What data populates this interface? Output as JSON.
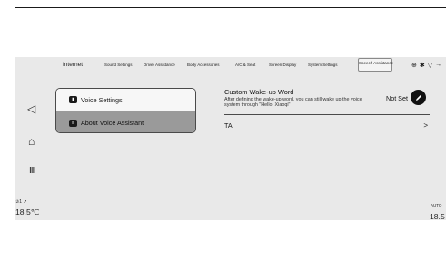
{
  "topbar": {
    "tabs": [
      {
        "label": "Internet"
      },
      {
        "label": "Sound Settings"
      },
      {
        "label": "Driver Assistance"
      },
      {
        "label": "Body Accessories"
      },
      {
        "label": "A/C & Seat"
      },
      {
        "label": "Screen Display"
      },
      {
        "label": "System Settings"
      },
      {
        "label": "Speech Assistance"
      }
    ],
    "active_tab": "Speech Assistance",
    "status_icons": [
      "location-icon",
      "bluetooth-icon",
      "wifi-icon",
      "signal-icon"
    ]
  },
  "sidebar": {
    "icons": [
      "back-icon",
      "home-icon",
      "apps-icon"
    ]
  },
  "menu": {
    "items": [
      {
        "label": "Voice Settings",
        "icon": "microphone-icon"
      },
      {
        "label": "About Voice Assistant",
        "icon": "chat-icon"
      }
    ],
    "selected": "About Voice Assistant"
  },
  "wake_word": {
    "title": "Custom Wake-up Word",
    "description": "After defining the wake-up word, you can still wake up the voice system through \"Hello, Xiaoqi\"",
    "status": "Not Set",
    "edit_icon": "pencil-icon"
  },
  "tai_row": {
    "label": "TAI",
    "chevron": ">"
  },
  "climate": {
    "left_fan": "✰1 ↗",
    "left_temp": "18.5℃",
    "right_mode": "AUTO",
    "right_temp": "18.5"
  },
  "colors": {
    "screen_bg": "#e9e9e9",
    "selected_item": "#9a9a9a",
    "accent_dark": "#111111"
  }
}
